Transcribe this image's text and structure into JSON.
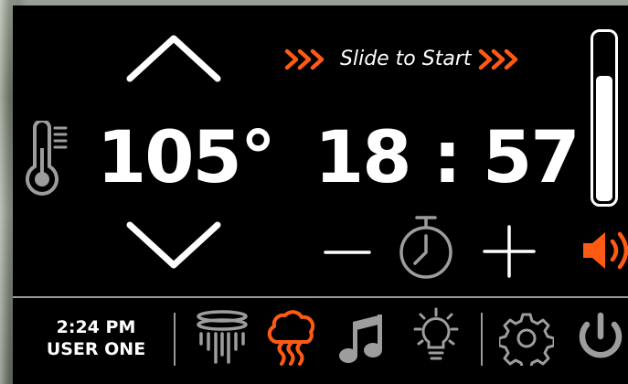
{
  "temperature": {
    "value": "105°"
  },
  "timer": {
    "value": "18 : 57"
  },
  "slide": {
    "label": "Slide to Start"
  },
  "volume": {
    "level": 0.76
  },
  "status": {
    "time": "2:24 PM",
    "user": "USER ONE"
  },
  "colors": {
    "accent": "#ff5a14",
    "foreground": "#ffffff",
    "icon_gray": "#9d9d9d",
    "background": "#000000"
  },
  "icons": [
    "thermometer-icon",
    "chevron-up-icon",
    "chevron-down-icon",
    "minus-icon",
    "timer-icon",
    "plus-icon",
    "speaker-icon",
    "rain-head-icon",
    "steam-icon",
    "music-icon",
    "light-bulb-icon",
    "settings-gear-icon",
    "power-icon"
  ],
  "modes": [
    {
      "name": "rain-head",
      "active": false
    },
    {
      "name": "steam",
      "active": true
    },
    {
      "name": "music",
      "active": false
    },
    {
      "name": "light",
      "active": false
    }
  ]
}
